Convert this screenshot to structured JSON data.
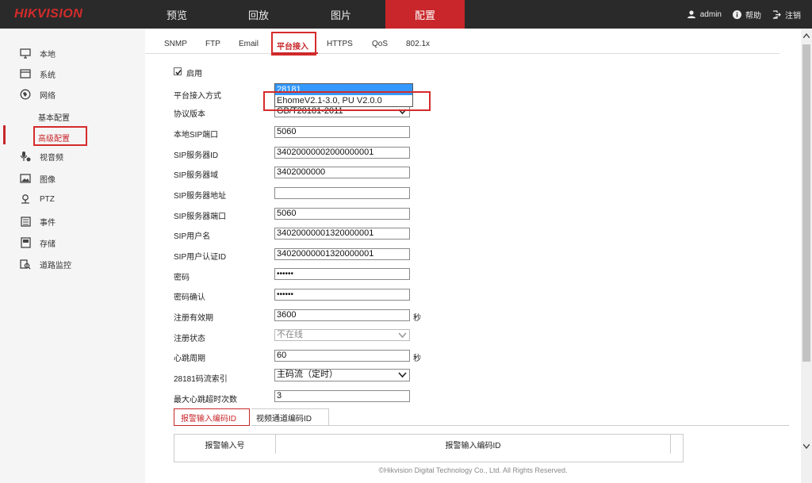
{
  "header": {
    "logo": "HIKVISION",
    "nav": [
      "预览",
      "回放",
      "图片",
      "配置"
    ],
    "active_nav": 3,
    "user": "admin",
    "help": "帮助",
    "logout": "注销"
  },
  "sidebar": {
    "items": [
      "本地",
      "系统",
      "网络",
      "视音频",
      "图像",
      "PTZ",
      "事件",
      "存储",
      "道路监控"
    ],
    "subs": [
      "基本配置",
      "高级配置"
    ]
  },
  "tabs": [
    "SNMP",
    "FTP",
    "Email",
    "平台接入",
    "HTTPS",
    "QoS",
    "802.1x"
  ],
  "form": {
    "enable_label": "启用",
    "enabled": true,
    "fields": [
      {
        "label": "平台接入方式",
        "value": "28181",
        "type": "select-open"
      },
      {
        "label": "协议版本",
        "value": "GB/T28181-2011",
        "type": "select"
      },
      {
        "label": "本地SIP端口",
        "value": "5060",
        "type": "text"
      },
      {
        "label": "SIP服务器ID",
        "value": "34020000002000000001",
        "type": "text"
      },
      {
        "label": "SIP服务器域",
        "value": "3402000000",
        "type": "text"
      },
      {
        "label": "SIP服务器地址",
        "value": "",
        "type": "text"
      },
      {
        "label": "SIP服务器端口",
        "value": "5060",
        "type": "text"
      },
      {
        "label": "SIP用户名",
        "value": "34020000001320000001",
        "type": "text"
      },
      {
        "label": "SIP用户认证ID",
        "value": "34020000001320000001",
        "type": "text"
      },
      {
        "label": "密码",
        "value": "••••••",
        "type": "password"
      },
      {
        "label": "密码确认",
        "value": "••••••",
        "type": "password"
      },
      {
        "label": "注册有效期",
        "value": "3600",
        "type": "text",
        "unit": "秒"
      },
      {
        "label": "注册状态",
        "value": "不在线",
        "type": "select-disabled"
      },
      {
        "label": "心跳周期",
        "value": "60",
        "type": "text",
        "unit": "秒"
      },
      {
        "label": "28181码流索引",
        "value": "主码流（定时）",
        "type": "select"
      },
      {
        "label": "最大心跳超时次数",
        "value": "3",
        "type": "text"
      }
    ],
    "dropdown_options": [
      "28181",
      "EhomeV2.1-3.0, PU V2.0.0"
    ]
  },
  "subtabs": [
    "报警输入编码ID",
    "视频通道编码ID"
  ],
  "table": {
    "headers": [
      "报警输入号",
      "报警输入编码ID"
    ]
  },
  "footer": "©Hikvision Digital Technology Co., Ltd. All Rights Reserved."
}
